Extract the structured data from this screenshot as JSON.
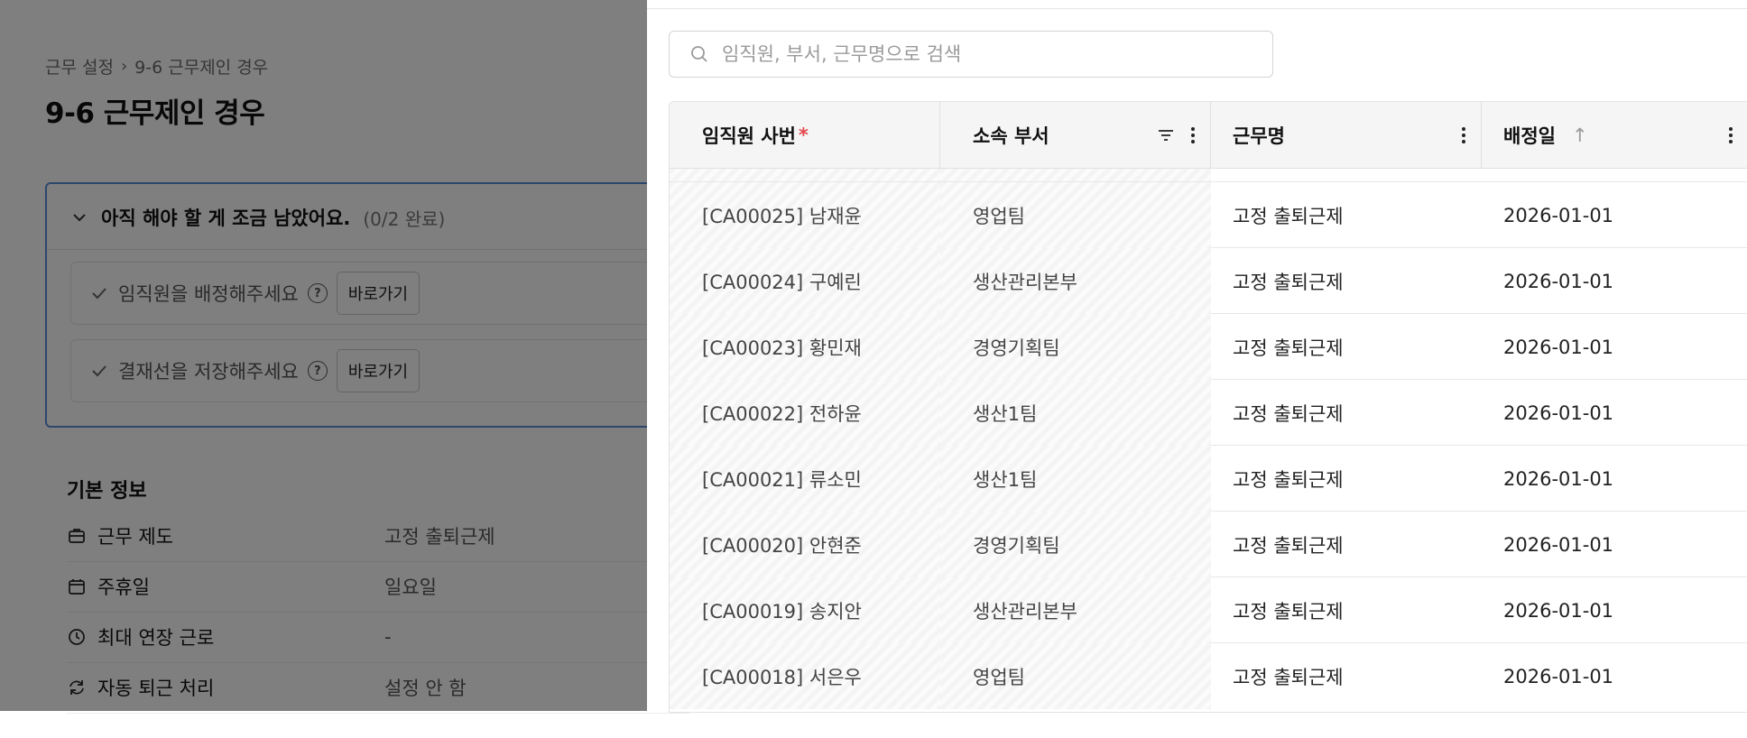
{
  "background": {
    "breadcrumb": {
      "parent": "근무 설정",
      "current": "9-6 근무제인 경우"
    },
    "page_title": "9-6 근무제인 경우",
    "todo": {
      "heading": "아직 해야 할 게 조금 남았어요.",
      "progress": "(0/2 완료)",
      "items": [
        {
          "label": "임직원을 배정해주세요",
          "button": "바로가기"
        },
        {
          "label": "결재선을 저장해주세요",
          "button": "바로가기"
        }
      ]
    },
    "info": {
      "title": "기본 정보",
      "rows": [
        {
          "icon": "briefcase-icon",
          "label": "근무 제도",
          "value": "고정 출퇴근제"
        },
        {
          "icon": "calendar-icon",
          "label": "주휴일",
          "value": "일요일"
        },
        {
          "icon": "clock-icon",
          "label": "최대 연장 근로",
          "value": "-"
        },
        {
          "icon": "refresh-icon",
          "label": "자동 퇴근 처리",
          "value": "설정 안 함"
        }
      ]
    }
  },
  "drawer": {
    "search_placeholder": "임직원, 부서, 근무명으로 검색",
    "columns": {
      "employee": "임직원 사번",
      "required_mark": "*",
      "department": "소속 부서",
      "work_name": "근무명",
      "assigned_date": "배정일",
      "sort_arrow": "↑"
    },
    "rows": [
      {
        "employee": "[CA00025] 남재윤",
        "department": "영업팀",
        "work": "고정 출퇴근제",
        "date": "2026-01-01"
      },
      {
        "employee": "[CA00024] 구예린",
        "department": "생산관리본부",
        "work": "고정 출퇴근제",
        "date": "2026-01-01"
      },
      {
        "employee": "[CA00023] 황민재",
        "department": "경영기획팀",
        "work": "고정 출퇴근제",
        "date": "2026-01-01"
      },
      {
        "employee": "[CA00022] 전하윤",
        "department": "생산1팀",
        "work": "고정 출퇴근제",
        "date": "2026-01-01"
      },
      {
        "employee": "[CA00021] 류소민",
        "department": "생산1팀",
        "work": "고정 출퇴근제",
        "date": "2026-01-01"
      },
      {
        "employee": "[CA00020] 안현준",
        "department": "경영기획팀",
        "work": "고정 출퇴근제",
        "date": "2026-01-01"
      },
      {
        "employee": "[CA00019] 송지안",
        "department": "생산관리본부",
        "work": "고정 출퇴근제",
        "date": "2026-01-01"
      },
      {
        "employee": "[CA00018] 서은우",
        "department": "영업팀",
        "work": "고정 출퇴근제",
        "date": "2026-01-01"
      }
    ]
  },
  "colors": {
    "overlay": "#000000",
    "accent_border": "#5b8fd9",
    "required": "#e5484d"
  }
}
